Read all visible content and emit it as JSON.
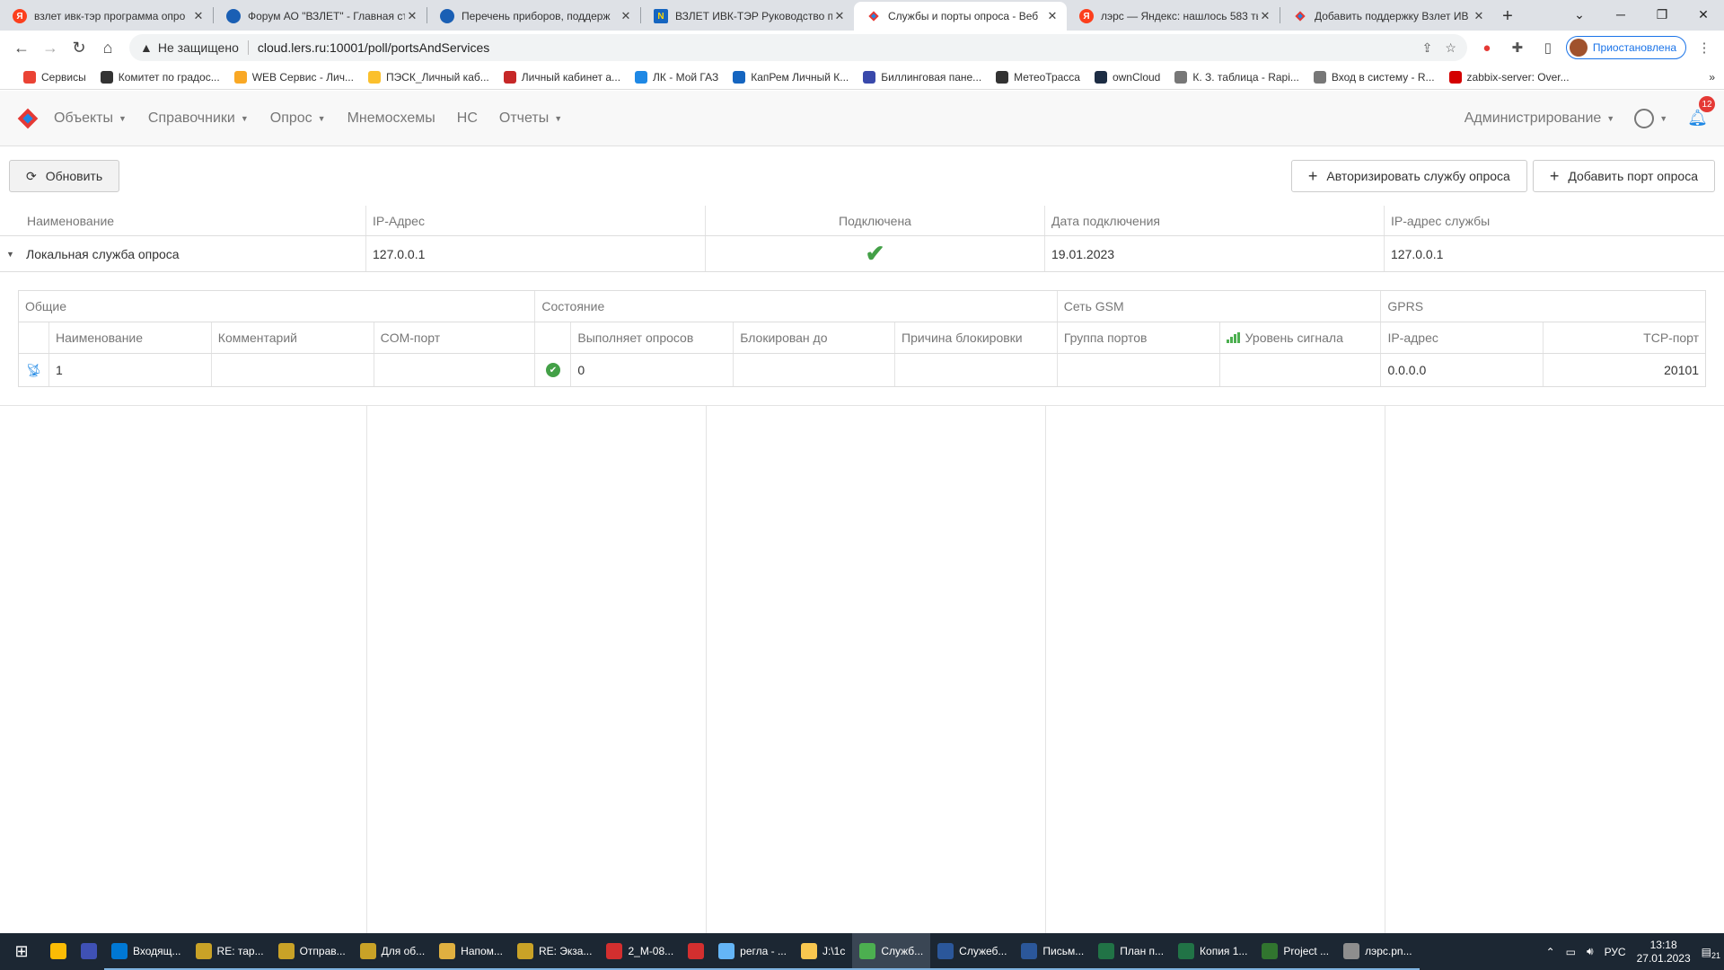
{
  "browser": {
    "tabs": [
      {
        "title": "взлет ивк-тэр программа опро",
        "favicon": "yandex"
      },
      {
        "title": "Форум АО \"ВЗЛЕТ\" - Главная ст",
        "favicon": "globe"
      },
      {
        "title": "Перечень приборов, поддерж",
        "favicon": "globe"
      },
      {
        "title": "ВЗЛЕТ ИВК-ТЭР Руководство п",
        "favicon": "nt"
      },
      {
        "title": "Службы и порты опроса - Веб",
        "favicon": "lers",
        "active": true
      },
      {
        "title": "лэрс — Яндекс: нашлось 583 ты",
        "favicon": "yandex"
      },
      {
        "title": "Добавить поддержку Взлет ИВ",
        "favicon": "lers"
      }
    ],
    "omnibox": {
      "security": "Не защищено",
      "url": "cloud.lers.ru:10001/poll/portsAndServices"
    },
    "profile_status": "Приостановлена",
    "bookmarks": [
      {
        "label": "Сервисы",
        "color": "#ea4335"
      },
      {
        "label": "Комитет по градос...",
        "color": "#333333"
      },
      {
        "label": "WEB Сервис - Лич...",
        "color": "#f9a825"
      },
      {
        "label": "ПЭСК_Личный каб...",
        "color": "#fbc02d"
      },
      {
        "label": "Личный кабинет а...",
        "color": "#c62828"
      },
      {
        "label": "ЛК - Мой ГАЗ",
        "color": "#1e88e5"
      },
      {
        "label": "КапРем Личный К...",
        "color": "#1565c0"
      },
      {
        "label": "Биллинговая пане...",
        "color": "#3949ab"
      },
      {
        "label": "МетеоТрасса",
        "color": "#333333"
      },
      {
        "label": "ownCloud",
        "color": "#1d2d44"
      },
      {
        "label": "К. З. таблица - Rapi...",
        "color": "#777777"
      },
      {
        "label": "Вход в систему - R...",
        "color": "#777777"
      },
      {
        "label": "zabbix-server: Over...",
        "color": "#d40000"
      }
    ]
  },
  "app": {
    "menu": [
      {
        "label": "Объекты",
        "dropdown": true
      },
      {
        "label": "Справочники",
        "dropdown": true
      },
      {
        "label": "Опрос",
        "dropdown": true
      },
      {
        "label": "Мнемосхемы",
        "dropdown": false
      },
      {
        "label": "НС",
        "dropdown": false
      },
      {
        "label": "Отчеты",
        "dropdown": true
      }
    ],
    "admin_label": "Администрирование",
    "notifications_count": "12"
  },
  "toolbar": {
    "refresh_label": "Обновить",
    "authorize_label": "Авторизировать службу опроса",
    "add_port_label": "Добавить порт опроса"
  },
  "services_table": {
    "columns": [
      "Наименование",
      "IP-Адрес",
      "Подключена",
      "Дата подключения",
      "IP-адрес службы"
    ],
    "rows": [
      {
        "name": "Локальная служба опроса",
        "ip": "127.0.0.1",
        "connected": true,
        "connect_date": "19.01.2023",
        "service_ip": "127.0.0.1"
      }
    ]
  },
  "ports_table": {
    "groups": [
      "Общие",
      "Состояние",
      "Сеть GSM",
      "GPRS"
    ],
    "columns": [
      "Наименование",
      "Комментарий",
      "COM-порт",
      "Выполняет опросов",
      "Блокирован до",
      "Причина блокировки",
      "Группа портов",
      "Уровень сигнала",
      "IP-адрес",
      "TCP-порт"
    ],
    "rows": [
      {
        "name": "1",
        "comment": "",
        "com_port": "",
        "state_ok": true,
        "polls": "0",
        "blocked_until": "",
        "block_reason": "",
        "port_group": "",
        "signal": "",
        "ip": "0.0.0.0",
        "tcp_port": "20101"
      }
    ]
  },
  "taskbar": {
    "apps": [
      {
        "label": "",
        "color": "#fbbc05"
      },
      {
        "label": "",
        "color": "#3f51b5"
      },
      {
        "label": "Входящ...",
        "color": "#0078d4",
        "run": true
      },
      {
        "label": "RE: тар...",
        "color": "#c9a227",
        "run": true
      },
      {
        "label": "Отправ...",
        "color": "#c9a227",
        "run": true
      },
      {
        "label": "Для об...",
        "color": "#c9a227",
        "run": true
      },
      {
        "label": "Напом...",
        "color": "#e0b040",
        "run": true
      },
      {
        "label": "RE: Экза...",
        "color": "#c9a227",
        "run": true
      },
      {
        "label": "2_М-08...",
        "color": "#d32f2f",
        "run": true
      },
      {
        "label": "",
        "color": "#d32f2f",
        "run": true
      },
      {
        "label": "регла - ...",
        "color": "#64b5f6",
        "run": true
      },
      {
        "label": "J:\\1с",
        "color": "#f9c74f",
        "run": true
      },
      {
        "label": "Служб...",
        "color": "#4caf50",
        "active": true
      },
      {
        "label": "Служеб...",
        "color": "#2b579a",
        "run": true
      },
      {
        "label": "Письм...",
        "color": "#2b579a",
        "run": true
      },
      {
        "label": "План п...",
        "color": "#217346",
        "run": true
      },
      {
        "label": "Копия 1...",
        "color": "#217346",
        "run": true
      },
      {
        "label": "Project ...",
        "color": "#31752f",
        "run": true
      },
      {
        "label": "лэрс.pn...",
        "color": "#8e8e8e",
        "run": true
      }
    ],
    "language": "РУС",
    "time": "13:18",
    "date": "27.01.2023",
    "notification_count": "21"
  }
}
